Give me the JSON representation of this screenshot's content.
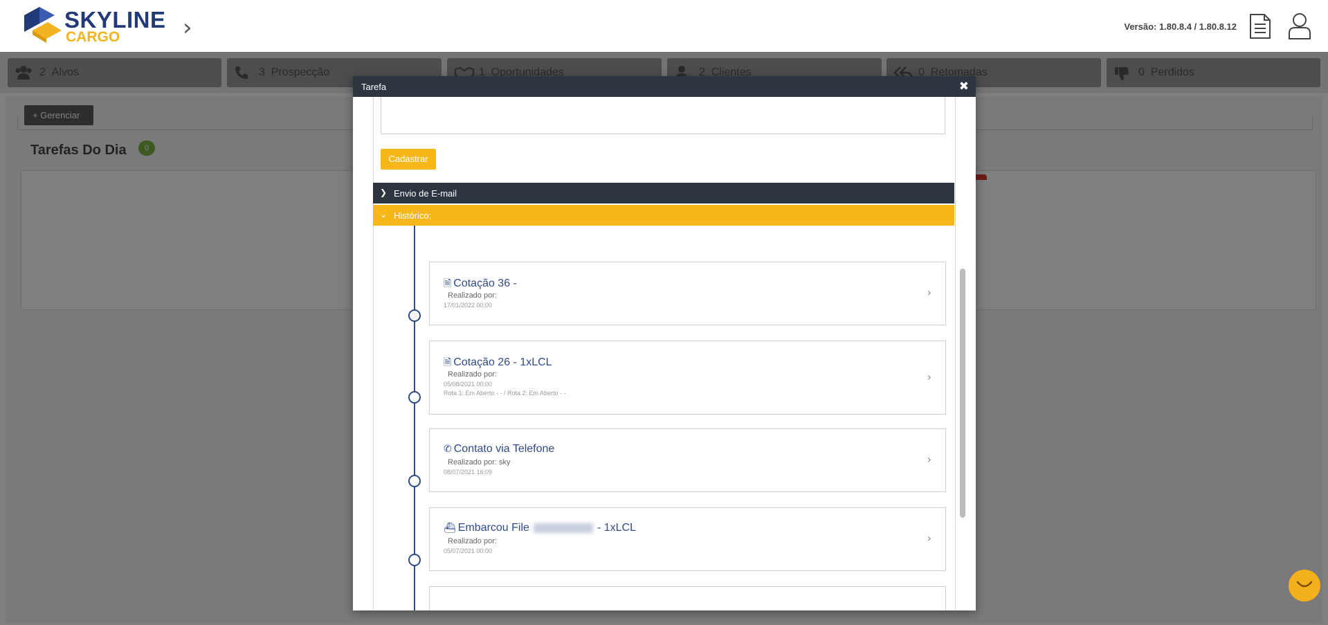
{
  "header": {
    "logo_primary": "SKYLINE",
    "logo_secondary": "CARGO",
    "version": "Versão: 1.80.8.4 / 1.80.8.12",
    "icons": [
      "chevron-right-icon",
      "document-icon",
      "user-icon"
    ]
  },
  "stages": [
    {
      "count": "2",
      "label": "Alvos",
      "icon": "users-icon"
    },
    {
      "count": "3",
      "label": "Prospecção",
      "icon": "phone-icon"
    },
    {
      "count": "1",
      "label": "Oportunidades",
      "icon": "handshake-icon"
    },
    {
      "count": "2",
      "label": "Clientes",
      "icon": "user-icon"
    },
    {
      "count": "0",
      "label": "Retomadas",
      "icon": "reply-all-icon"
    },
    {
      "count": "0",
      "label": "Perdidos",
      "icon": "thumbs-down-icon"
    }
  ],
  "page": {
    "manage_button": "+ Gerenciar",
    "tasks_title": "Tarefas Do Dia",
    "tasks_count": "0"
  },
  "modal": {
    "title": "Tarefa",
    "close": "✖",
    "register_button": "Cadastrar",
    "email_section": "Envio de E-mail",
    "history_section": "Histórico:",
    "history": [
      {
        "icon": "document-icon",
        "title": "Cotação 36 -",
        "performed_by": "Realizado por:",
        "date": "17/01/2022 00:00",
        "route": ""
      },
      {
        "icon": "document-icon",
        "title": "Cotação 26 - 1xLCL",
        "performed_by": "Realizado por:",
        "date": "05/08/2021 00:00",
        "route": "Rota 1: Em Aberto - - / Rota 2: Em Aberto - -"
      },
      {
        "icon": "phone-icon",
        "title": "Contato via Telefone",
        "performed_by": "Realizado por: sky",
        "date": "08/07/2021 16:09",
        "route": ""
      },
      {
        "icon": "ship-icon",
        "title_prefix": "Embarcou File",
        "title_suffix": "- 1xLCL",
        "performed_by": "Realizado por:",
        "date": "05/07/2021 00:00",
        "route": ""
      }
    ]
  },
  "colors": {
    "brand_navy": "#223a78",
    "brand_yellow": "#f7b718",
    "modal_header": "#2d3640",
    "badge_green": "#7cb342"
  }
}
